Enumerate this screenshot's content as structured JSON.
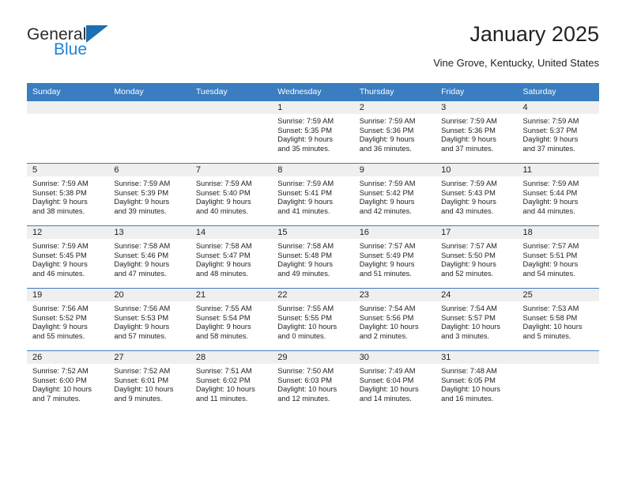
{
  "logo": {
    "text_top": "General",
    "text_bottom": "Blue",
    "triangle_icon": "blue-triangle-icon",
    "color_dark": "#2b2b2b",
    "color_blue": "#1d84d6"
  },
  "header": {
    "title": "January 2025",
    "subtitle": "Vine Grove, Kentucky, United States"
  },
  "theme": {
    "header_bg": "#3a7dc0",
    "header_text": "#ffffff",
    "daynum_bg": "#efefef",
    "cell_bg": "#ffffff",
    "text": "#222222"
  },
  "calendar": {
    "weekday_headers": [
      "Sunday",
      "Monday",
      "Tuesday",
      "Wednesday",
      "Thursday",
      "Friday",
      "Saturday"
    ],
    "weeks": [
      [
        {
          "day": "",
          "empty": true
        },
        {
          "day": "",
          "empty": true
        },
        {
          "day": "",
          "empty": true
        },
        {
          "day": "1",
          "sunrise": "Sunrise: 7:59 AM",
          "sunset": "Sunset: 5:35 PM",
          "daylight_1": "Daylight: 9 hours",
          "daylight_2": "and 35 minutes."
        },
        {
          "day": "2",
          "sunrise": "Sunrise: 7:59 AM",
          "sunset": "Sunset: 5:36 PM",
          "daylight_1": "Daylight: 9 hours",
          "daylight_2": "and 36 minutes."
        },
        {
          "day": "3",
          "sunrise": "Sunrise: 7:59 AM",
          "sunset": "Sunset: 5:36 PM",
          "daylight_1": "Daylight: 9 hours",
          "daylight_2": "and 37 minutes."
        },
        {
          "day": "4",
          "sunrise": "Sunrise: 7:59 AM",
          "sunset": "Sunset: 5:37 PM",
          "daylight_1": "Daylight: 9 hours",
          "daylight_2": "and 37 minutes."
        }
      ],
      [
        {
          "day": "5",
          "sunrise": "Sunrise: 7:59 AM",
          "sunset": "Sunset: 5:38 PM",
          "daylight_1": "Daylight: 9 hours",
          "daylight_2": "and 38 minutes."
        },
        {
          "day": "6",
          "sunrise": "Sunrise: 7:59 AM",
          "sunset": "Sunset: 5:39 PM",
          "daylight_1": "Daylight: 9 hours",
          "daylight_2": "and 39 minutes."
        },
        {
          "day": "7",
          "sunrise": "Sunrise: 7:59 AM",
          "sunset": "Sunset: 5:40 PM",
          "daylight_1": "Daylight: 9 hours",
          "daylight_2": "and 40 minutes."
        },
        {
          "day": "8",
          "sunrise": "Sunrise: 7:59 AM",
          "sunset": "Sunset: 5:41 PM",
          "daylight_1": "Daylight: 9 hours",
          "daylight_2": "and 41 minutes."
        },
        {
          "day": "9",
          "sunrise": "Sunrise: 7:59 AM",
          "sunset": "Sunset: 5:42 PM",
          "daylight_1": "Daylight: 9 hours",
          "daylight_2": "and 42 minutes."
        },
        {
          "day": "10",
          "sunrise": "Sunrise: 7:59 AM",
          "sunset": "Sunset: 5:43 PM",
          "daylight_1": "Daylight: 9 hours",
          "daylight_2": "and 43 minutes."
        },
        {
          "day": "11",
          "sunrise": "Sunrise: 7:59 AM",
          "sunset": "Sunset: 5:44 PM",
          "daylight_1": "Daylight: 9 hours",
          "daylight_2": "and 44 minutes."
        }
      ],
      [
        {
          "day": "12",
          "sunrise": "Sunrise: 7:59 AM",
          "sunset": "Sunset: 5:45 PM",
          "daylight_1": "Daylight: 9 hours",
          "daylight_2": "and 46 minutes."
        },
        {
          "day": "13",
          "sunrise": "Sunrise: 7:58 AM",
          "sunset": "Sunset: 5:46 PM",
          "daylight_1": "Daylight: 9 hours",
          "daylight_2": "and 47 minutes."
        },
        {
          "day": "14",
          "sunrise": "Sunrise: 7:58 AM",
          "sunset": "Sunset: 5:47 PM",
          "daylight_1": "Daylight: 9 hours",
          "daylight_2": "and 48 minutes."
        },
        {
          "day": "15",
          "sunrise": "Sunrise: 7:58 AM",
          "sunset": "Sunset: 5:48 PM",
          "daylight_1": "Daylight: 9 hours",
          "daylight_2": "and 49 minutes."
        },
        {
          "day": "16",
          "sunrise": "Sunrise: 7:57 AM",
          "sunset": "Sunset: 5:49 PM",
          "daylight_1": "Daylight: 9 hours",
          "daylight_2": "and 51 minutes."
        },
        {
          "day": "17",
          "sunrise": "Sunrise: 7:57 AM",
          "sunset": "Sunset: 5:50 PM",
          "daylight_1": "Daylight: 9 hours",
          "daylight_2": "and 52 minutes."
        },
        {
          "day": "18",
          "sunrise": "Sunrise: 7:57 AM",
          "sunset": "Sunset: 5:51 PM",
          "daylight_1": "Daylight: 9 hours",
          "daylight_2": "and 54 minutes."
        }
      ],
      [
        {
          "day": "19",
          "sunrise": "Sunrise: 7:56 AM",
          "sunset": "Sunset: 5:52 PM",
          "daylight_1": "Daylight: 9 hours",
          "daylight_2": "and 55 minutes."
        },
        {
          "day": "20",
          "sunrise": "Sunrise: 7:56 AM",
          "sunset": "Sunset: 5:53 PM",
          "daylight_1": "Daylight: 9 hours",
          "daylight_2": "and 57 minutes."
        },
        {
          "day": "21",
          "sunrise": "Sunrise: 7:55 AM",
          "sunset": "Sunset: 5:54 PM",
          "daylight_1": "Daylight: 9 hours",
          "daylight_2": "and 58 minutes."
        },
        {
          "day": "22",
          "sunrise": "Sunrise: 7:55 AM",
          "sunset": "Sunset: 5:55 PM",
          "daylight_1": "Daylight: 10 hours",
          "daylight_2": "and 0 minutes."
        },
        {
          "day": "23",
          "sunrise": "Sunrise: 7:54 AM",
          "sunset": "Sunset: 5:56 PM",
          "daylight_1": "Daylight: 10 hours",
          "daylight_2": "and 2 minutes."
        },
        {
          "day": "24",
          "sunrise": "Sunrise: 7:54 AM",
          "sunset": "Sunset: 5:57 PM",
          "daylight_1": "Daylight: 10 hours",
          "daylight_2": "and 3 minutes."
        },
        {
          "day": "25",
          "sunrise": "Sunrise: 7:53 AM",
          "sunset": "Sunset: 5:58 PM",
          "daylight_1": "Daylight: 10 hours",
          "daylight_2": "and 5 minutes."
        }
      ],
      [
        {
          "day": "26",
          "sunrise": "Sunrise: 7:52 AM",
          "sunset": "Sunset: 6:00 PM",
          "daylight_1": "Daylight: 10 hours",
          "daylight_2": "and 7 minutes."
        },
        {
          "day": "27",
          "sunrise": "Sunrise: 7:52 AM",
          "sunset": "Sunset: 6:01 PM",
          "daylight_1": "Daylight: 10 hours",
          "daylight_2": "and 9 minutes."
        },
        {
          "day": "28",
          "sunrise": "Sunrise: 7:51 AM",
          "sunset": "Sunset: 6:02 PM",
          "daylight_1": "Daylight: 10 hours",
          "daylight_2": "and 11 minutes."
        },
        {
          "day": "29",
          "sunrise": "Sunrise: 7:50 AM",
          "sunset": "Sunset: 6:03 PM",
          "daylight_1": "Daylight: 10 hours",
          "daylight_2": "and 12 minutes."
        },
        {
          "day": "30",
          "sunrise": "Sunrise: 7:49 AM",
          "sunset": "Sunset: 6:04 PM",
          "daylight_1": "Daylight: 10 hours",
          "daylight_2": "and 14 minutes."
        },
        {
          "day": "31",
          "sunrise": "Sunrise: 7:48 AM",
          "sunset": "Sunset: 6:05 PM",
          "daylight_1": "Daylight: 10 hours",
          "daylight_2": "and 16 minutes."
        },
        {
          "day": "",
          "empty": true
        }
      ]
    ]
  }
}
